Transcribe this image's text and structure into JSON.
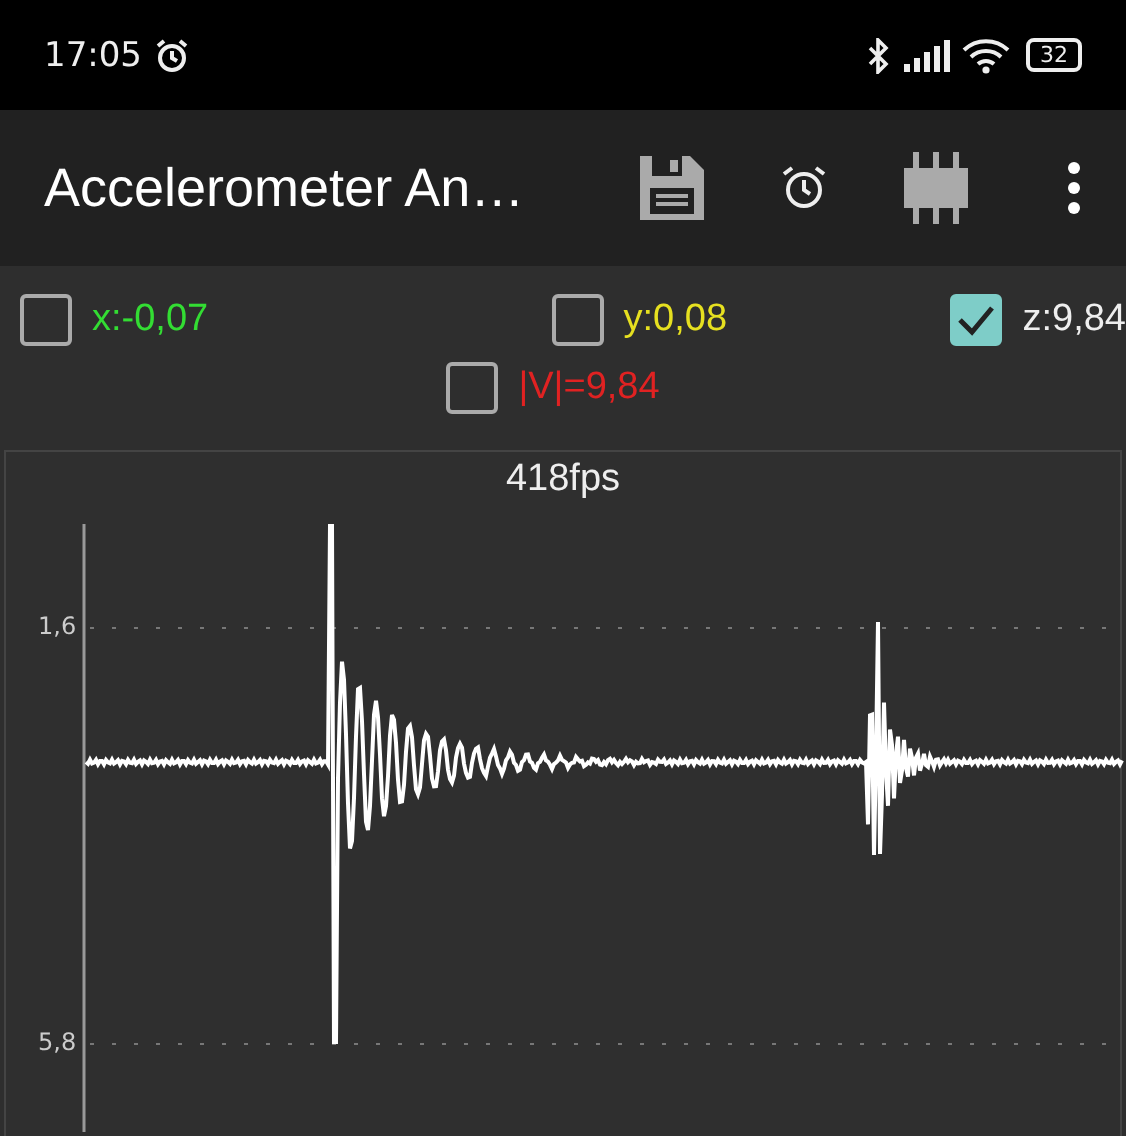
{
  "status_bar": {
    "time": "17:05",
    "battery": "32"
  },
  "toolbar": {
    "title": "Accelerometer An…"
  },
  "channels": [
    {
      "label": "x:-0,07",
      "checked": false,
      "color": "#33dd33"
    },
    {
      "label": "y:0,08",
      "checked": false,
      "color": "#e6e020"
    },
    {
      "label": "z:9,84",
      "checked": true,
      "color": "#eeeeee"
    },
    {
      "label": "|V|=9,84",
      "checked": false,
      "color": "#e02222"
    }
  ],
  "graph": {
    "fps": "418fps",
    "y_labels": [
      "1,6",
      "5,8"
    ]
  }
}
